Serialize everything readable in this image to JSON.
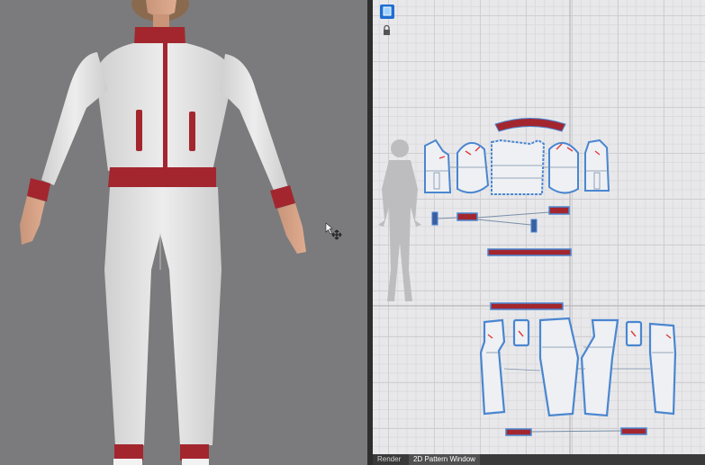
{
  "app": {
    "viewport_3d": {
      "background": "#7b7b7d",
      "garment_color": "#e6e6e6",
      "trim_color": "#a3262f"
    },
    "pattern_window": {
      "background": "#e8e8ea",
      "piece_outline": "#4a86d0",
      "trim_fill": "#a3262f"
    }
  },
  "toolbar": {
    "tools": [
      {
        "icon": "layer-select-icon"
      },
      {
        "icon": "lock-icon"
      }
    ]
  },
  "tabs": [
    {
      "label": "Render",
      "active": false
    },
    {
      "label": "2D Pattern Window",
      "active": true
    }
  ]
}
